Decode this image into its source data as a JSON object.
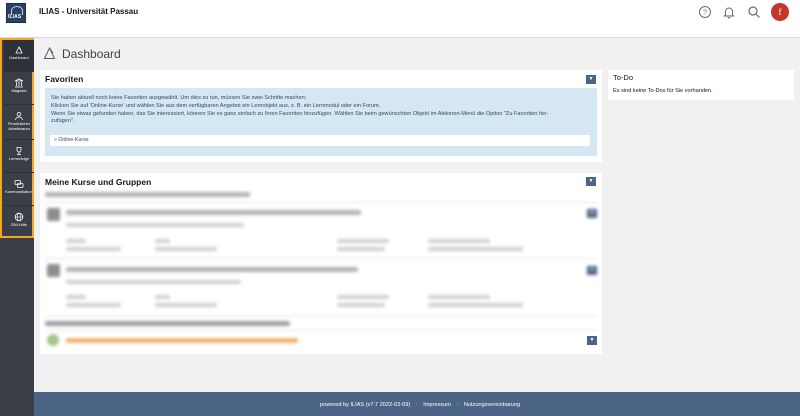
{
  "header": {
    "logo_text": "ILIAS",
    "title": "ILIAS - Universität Passau",
    "avatar_initial": "f",
    "avatar_color": "#c0392b"
  },
  "mainbar": {
    "items": [
      {
        "label": "Dashboard",
        "icon": "dashboard-icon"
      },
      {
        "label": "Magazin",
        "icon": "repository-icon"
      },
      {
        "label": "Persönlicher Arbeitsraum",
        "icon": "workspace-icon"
      },
      {
        "label": "Lernerfolge",
        "icon": "trophy-icon"
      },
      {
        "label": "Kommunikation",
        "icon": "communication-icon"
      },
      {
        "label": "ZIM-Hilfe",
        "icon": "help-globe-icon"
      }
    ],
    "highlight_color": "#f5a623"
  },
  "page": {
    "title": "Dashboard"
  },
  "favorites": {
    "heading": "Favoriten",
    "info_lines": [
      "Sie haben aktuell noch keine Favoriten ausgewählt. Um dies zu tun, müssen Sie zwei Schritte machen:",
      "Klicken Sie auf 'Online-Kurse' und wählen Sie aus dem verfügbaren Angebot ein Lernobjekt aus, z. B. ein Lernmodul oder ein Forum.",
      "Wenn Sie etwas gefunden haben, das Sie interessiert, können Sie es ganz einfach zu Ihren Favoriten hinzufügen. Wählen Sie beim gewünschten Objekt im Aktionen-Menü die Option \"Zu Favoriten hin-",
      "zufügen\"."
    ],
    "link": "» Online-Kurse"
  },
  "courses": {
    "heading": "Meine Kurse und Gruppen"
  },
  "todo": {
    "heading": "To-Do",
    "empty": "Es sind keine To-Dos für Sie vorhanden."
  },
  "footer": {
    "powered": "powered by ILIAS (v7.7 2022-03-09)",
    "sep": "·",
    "impressum": "Impressum",
    "terms": "Nutzungsvereinbarung"
  },
  "colors": {
    "accent": "#4c6586",
    "info_bg": "#d6e7f4",
    "mainbar_bg": "#3a3f47"
  }
}
